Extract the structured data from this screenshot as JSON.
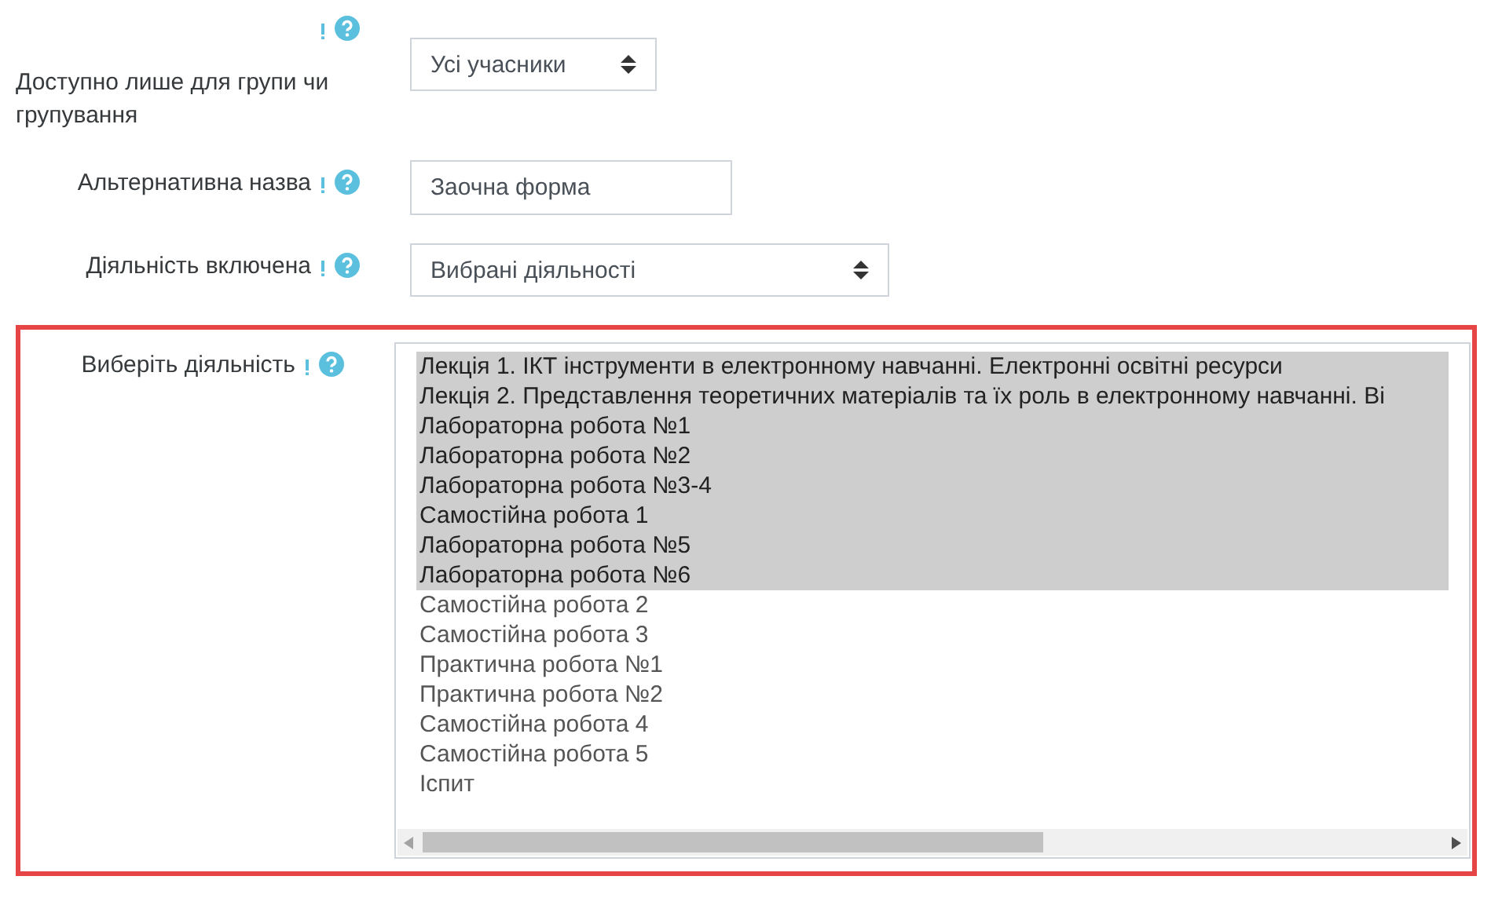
{
  "fields": [
    {
      "kind": "select",
      "label": "Доступно лише для групи чи групування",
      "value": "Усі учасники"
    },
    {
      "kind": "text",
      "label": "Альтернативна назва",
      "value": "Заочна форма"
    },
    {
      "kind": "select",
      "label": "Діяльність включена",
      "value": "Вибрані діяльності"
    },
    {
      "kind": "listbox",
      "label": "Виберіть діяльність",
      "highlighted": true,
      "options": [
        {
          "text": "Лекція 1. ІКТ інструменти в електронному навчанні. Електронні освітні ресурси",
          "selected": true
        },
        {
          "text": "Лекція 2. Представлення теоретичних матеріалів та їх роль в електронному навчанні. Ві",
          "selected": true
        },
        {
          "text": "Лабораторна робота №1",
          "selected": true
        },
        {
          "text": "Лабораторна робота №2",
          "selected": true
        },
        {
          "text": "Лабораторна робота №3-4",
          "selected": true
        },
        {
          "text": "Самостійна робота 1",
          "selected": true
        },
        {
          "text": "Лабораторна робота №5",
          "selected": true
        },
        {
          "text": "Лабораторна робота №6",
          "selected": true
        },
        {
          "text": "Самостійна робота 2",
          "selected": false
        },
        {
          "text": "Самостійна робота 3",
          "selected": false
        },
        {
          "text": "Практична робота №1",
          "selected": false
        },
        {
          "text": "Практична робота №2",
          "selected": false
        },
        {
          "text": "Самостійна робота 4",
          "selected": false
        },
        {
          "text": "Самостійна робота 5",
          "selected": false
        },
        {
          "text": "Іспит",
          "selected": false
        }
      ]
    }
  ]
}
